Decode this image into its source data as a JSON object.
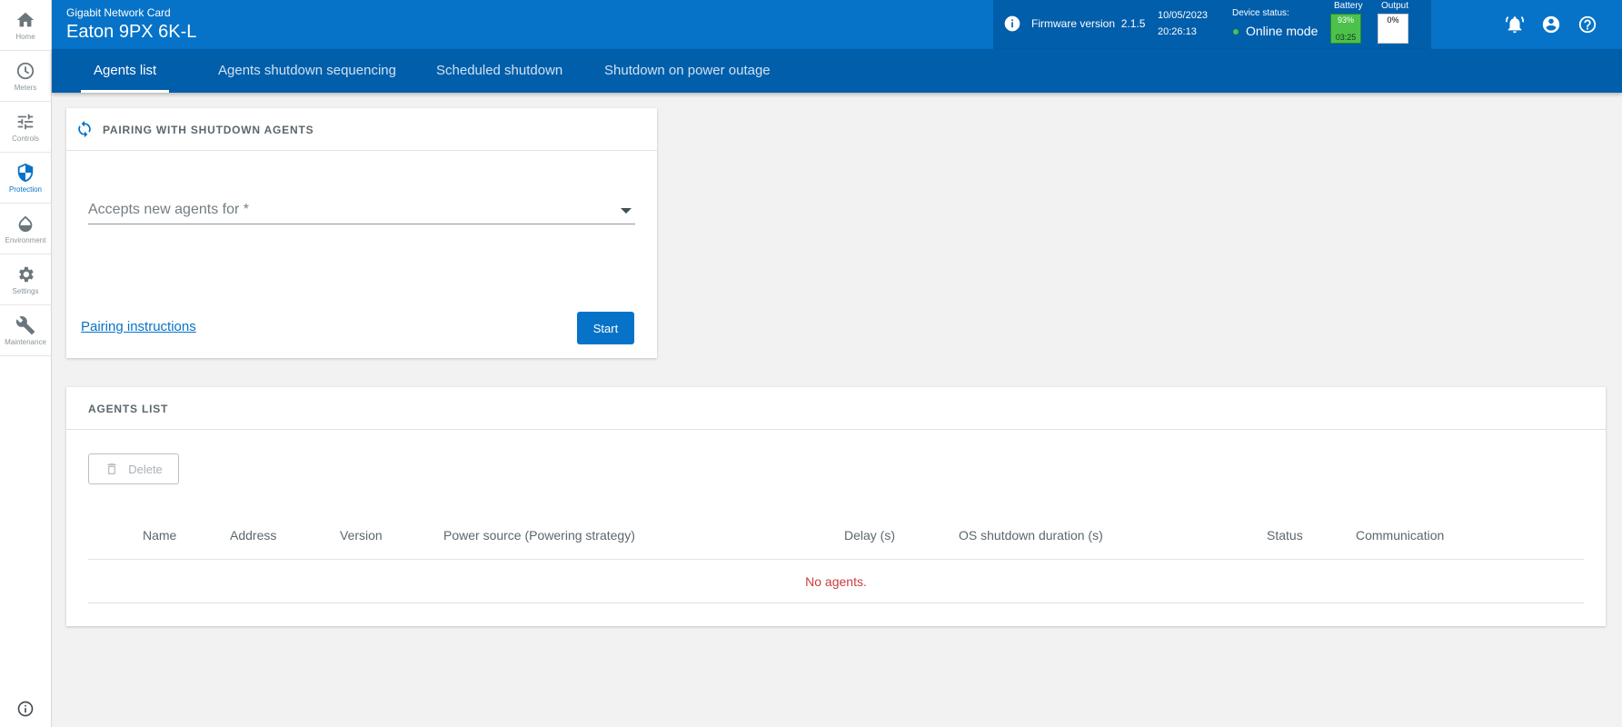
{
  "sidebar": {
    "items": [
      {
        "label": "Home",
        "icon": "home-icon"
      },
      {
        "label": "Meters",
        "icon": "gauge-icon"
      },
      {
        "label": "Controls",
        "icon": "sliders-icon"
      },
      {
        "label": "Protection",
        "icon": "shield-icon",
        "active": true
      },
      {
        "label": "Environment",
        "icon": "drop-icon"
      },
      {
        "label": "Settings",
        "icon": "gear-icon"
      },
      {
        "label": "Maintenance",
        "icon": "wrench-icon"
      }
    ]
  },
  "header": {
    "subtitle": "Gigabit Network Card",
    "title": "Eaton 9PX 6K-L",
    "firmware_label": "Firmware version",
    "firmware_version": "2.1.5",
    "date": "10/05/2023",
    "time": "20:26:13",
    "device_status_label": "Device status:",
    "device_status_value": "Online mode",
    "battery_label": "Battery",
    "battery_percent": "93%",
    "battery_runtime": "03:25",
    "output_label": "Output",
    "output_percent": "0%"
  },
  "tabs": [
    {
      "label": "Agents list",
      "active": true
    },
    {
      "label": "Agents shutdown sequencing"
    },
    {
      "label": "Scheduled shutdown"
    },
    {
      "label": "Shutdown on power outage"
    }
  ],
  "pairing": {
    "title": "PAIRING WITH SHUTDOWN AGENTS",
    "select_placeholder": "Accepts new agents for *",
    "instructions_link": "Pairing instructions",
    "start_button": "Start"
  },
  "agents": {
    "title": "AGENTS LIST",
    "delete_button": "Delete",
    "columns": [
      "Name",
      "Address",
      "Version",
      "Power source (Powering strategy)",
      "Delay (s)",
      "OS shutdown duration (s)",
      "Status",
      "Communication"
    ],
    "empty_message": "No agents."
  },
  "colors": {
    "brand": "#0673c8",
    "brand_dark": "#005eab",
    "battery_green": "#4cc14b",
    "error": "#ca3c3d"
  }
}
